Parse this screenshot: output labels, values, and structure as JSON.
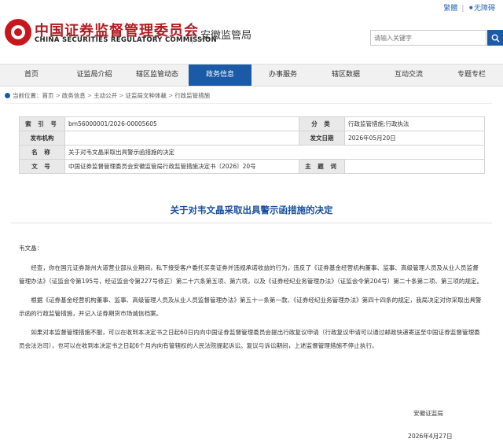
{
  "header": {
    "logo_cn": "中国证券监督管理委员会",
    "logo_en": "CHINA SECURITIES REGULATORY COMMISSION",
    "bureau": "安徽监管局",
    "util_traditional": "繁體",
    "util_accessible": "无障碍",
    "search_placeholder": "请输入关键字"
  },
  "nav": {
    "items": [
      {
        "label": "首页"
      },
      {
        "label": "证监局介绍"
      },
      {
        "label": "辖区监管动态"
      },
      {
        "label": "政务信息"
      },
      {
        "label": "办事服务"
      },
      {
        "label": "辖区数据"
      },
      {
        "label": "互动交流"
      },
      {
        "label": "专题专栏"
      }
    ],
    "active_index": 3
  },
  "breadcrumb": {
    "prefix": "当前位置：",
    "items": [
      "首页",
      "政务信息",
      "主动公开",
      "证监局文种体裁",
      "行政监管措施"
    ]
  },
  "info_table": {
    "index_label": "索 引 号",
    "index_value": "bm56000001/2026-00005605",
    "category_label": "分  类",
    "category_value": "行政监管措施;行政执法",
    "publisher_label": "发布机构",
    "publisher_value": "",
    "date_label": "发文日期",
    "date_value": "2026年05月20日",
    "name_label": "名  称",
    "name_value": "关于对韦文晶采取出具警示函措施的决定",
    "docno_label": "文  号",
    "docno_value": "中国证券监督管理委员会安徽监管局行政监管措施决定书〔2026〕20号",
    "subject_label": "主 题 词",
    "subject_value": ""
  },
  "document": {
    "title": "关于对韦文晶采取出具警示函措施的决定",
    "addressee": "韦文晶：",
    "paragraphs": [
      "经查，你在国元证券滁州大道营业部从业期间，私下接受客户委托买卖证券并违规承诺收益的行为，违反了《证券基金经营机构董事、监事、高级管理人员及从业人员监督管理办法》（证监会令第195号，经证监会令第227号修正）第二十六条第五项、第六项，以及《证券经纪业务管理办法》（证监会令第204号）第二十条第二项、第三项的规定。",
      "根据《证券基金经营机构董事、监事、高级管理人员及从业人员监督管理办法》第五十一条第一款、《证券经纪业务管理办法》第四十四条的规定，我局决定对你采取出具警示函的行政监管措施，并记入证券期货市场诚信档案。",
      "如果对本监督管理措施不服，可以在收到本决定书之日起60日内向中国证券监督管理委员会提出行政复议申请（行政复议申请可以通过邮政快递寄送至中国证券监督管理委员会法治司），也可以在收到本决定书之日起6个月内向有管辖权的人民法院提起诉讼。复议与诉讼期间，上述监督管理措施不停止执行。"
    ],
    "signature_org": "安徽证监局",
    "signature_date": "2026年4月27日"
  }
}
